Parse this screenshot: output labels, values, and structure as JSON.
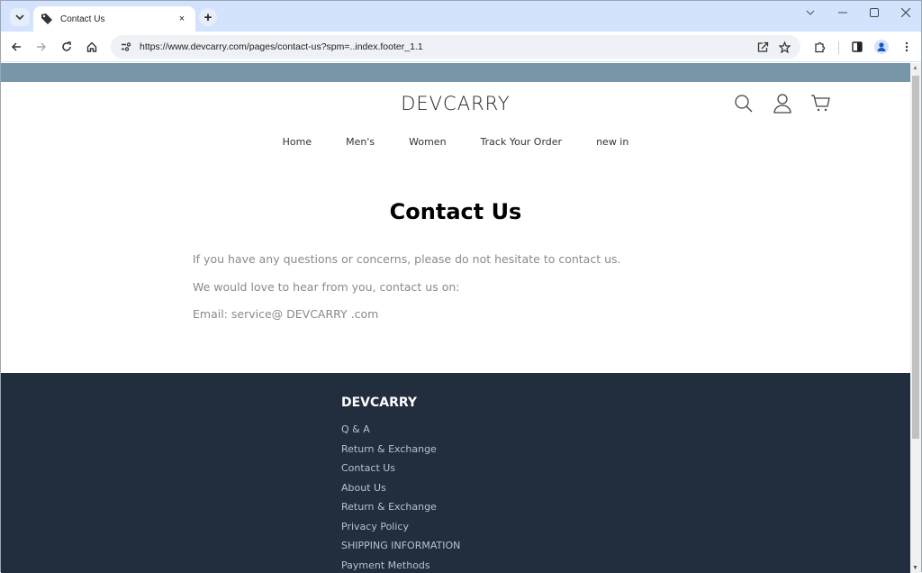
{
  "browser": {
    "tab": {
      "title": "Contact Us",
      "close_label": "×"
    },
    "new_tab_label": "+",
    "tab_search_label": "⌄",
    "window_controls": {
      "dropdown": "⌄",
      "minimize": "—",
      "maximize": "☐",
      "close": "✕"
    },
    "nav": {
      "back": "←",
      "forward": "→",
      "reload": "↻",
      "home": "⌂"
    },
    "url": "https://www.devcarry.com/pages/contact-us?spm=..index.footer_1.1"
  },
  "site": {
    "logo": "DEVCARRY",
    "nav": [
      "Home",
      "Men's",
      "Women",
      "Track Your Order",
      "new in"
    ],
    "icons": [
      "search-icon",
      "account-icon",
      "cart-icon"
    ]
  },
  "page": {
    "title": "Contact Us",
    "paragraphs": [
      "If you have any questions or concerns, please do not hesitate to contact us.",
      "We would love to hear from you, contact us on:",
      "Email: service@ DEVCARRY .com"
    ]
  },
  "footer": {
    "brand": "DEVCARRY",
    "links": [
      "Q & A",
      "Return & Exchange",
      "Contact Us",
      "About Us",
      "Return & Exchange",
      "Privacy Policy",
      "SHIPPING INFORMATION",
      "Payment Methods"
    ]
  },
  "colors": {
    "announcement_bar": "#7797a8",
    "footer_bg": "#222e3e",
    "tabstrip_bg": "#d3e3fd"
  }
}
